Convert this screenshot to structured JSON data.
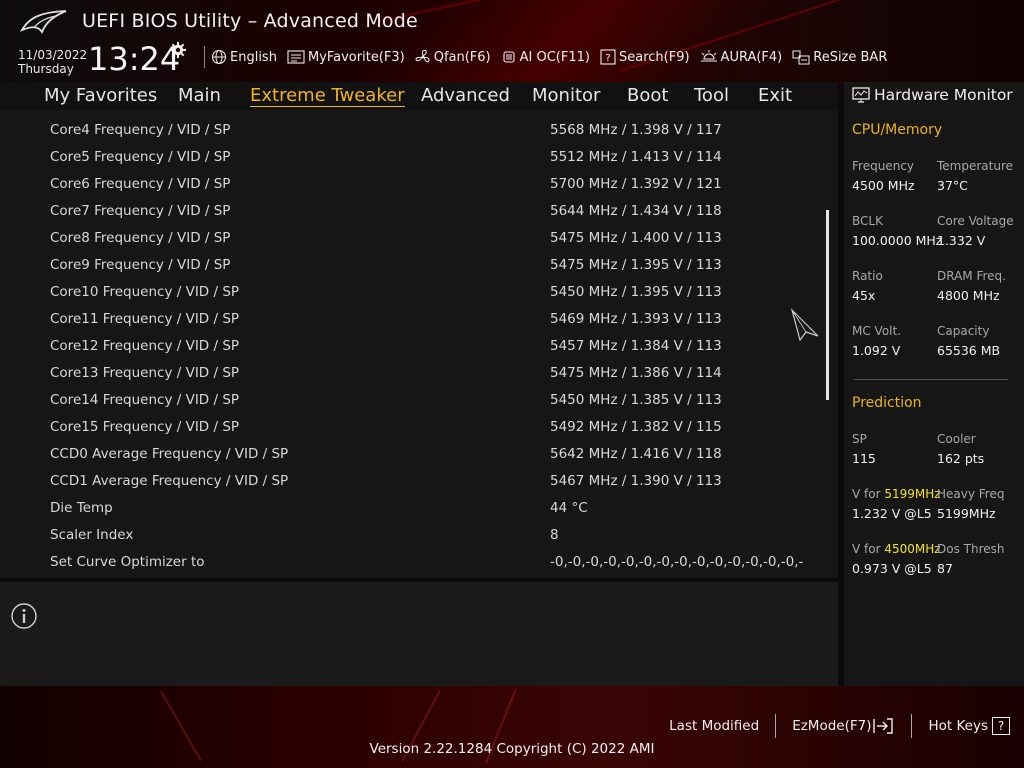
{
  "header": {
    "app_title": "UEFI BIOS Utility – Advanced Mode",
    "date": "11/03/2022",
    "day": "Thursday",
    "time": "13:24",
    "toolbar": [
      {
        "label": "English",
        "icon": "globe-icon"
      },
      {
        "label": "MyFavorite(F3)",
        "icon": "favorite-icon"
      },
      {
        "label": "Qfan(F6)",
        "icon": "fan-icon"
      },
      {
        "label": "AI OC(F11)",
        "icon": "ai-chip-icon"
      },
      {
        "label": "Search(F9)",
        "icon": "search-icon"
      },
      {
        "label": "AURA(F4)",
        "icon": "aura-icon"
      },
      {
        "label": "ReSize BAR",
        "icon": "resize-bar-icon"
      }
    ]
  },
  "nav": {
    "tabs": [
      "My Favorites",
      "Main",
      "Extreme Tweaker",
      "Advanced",
      "Monitor",
      "Boot",
      "Tool",
      "Exit"
    ],
    "active": "Extreme Tweaker"
  },
  "rows": [
    {
      "label": "Core4 Frequency / VID / SP",
      "value": "5568 MHz / 1.398 V / 117"
    },
    {
      "label": "Core5 Frequency / VID / SP",
      "value": "5512 MHz / 1.413 V / 114"
    },
    {
      "label": "Core6 Frequency / VID / SP",
      "value": "5700 MHz / 1.392 V / 121"
    },
    {
      "label": "Core7 Frequency / VID / SP",
      "value": "5644 MHz / 1.434 V / 118"
    },
    {
      "label": "Core8 Frequency / VID / SP",
      "value": "5475 MHz / 1.400 V / 113"
    },
    {
      "label": "Core9 Frequency / VID / SP",
      "value": "5475 MHz / 1.395 V / 113"
    },
    {
      "label": "Core10 Frequency / VID / SP",
      "value": "5450 MHz / 1.395 V / 113"
    },
    {
      "label": "Core11 Frequency / VID / SP",
      "value": "5469 MHz / 1.393 V / 113"
    },
    {
      "label": "Core12 Frequency / VID / SP",
      "value": "5457 MHz / 1.384 V / 113"
    },
    {
      "label": "Core13 Frequency / VID / SP",
      "value": "5475 MHz / 1.386 V / 114"
    },
    {
      "label": "Core14 Frequency / VID / SP",
      "value": "5450 MHz / 1.385 V / 113"
    },
    {
      "label": "Core15 Frequency / VID / SP",
      "value": "5492 MHz / 1.382 V / 115"
    },
    {
      "label": "CCD0 Average Frequency / VID / SP",
      "value": "5642 MHz / 1.416 V / 118"
    },
    {
      "label": "CCD1 Average Frequency / VID / SP",
      "value": "5467 MHz / 1.390 V / 113"
    },
    {
      "label": "Die Temp",
      "value": "44 °C"
    },
    {
      "label": "Scaler Index",
      "value": "8"
    },
    {
      "label": "Set Curve Optimizer to",
      "value": "-0,-0,-0,-0,-0,-0,-0,-0,-0,-0,-0,-0,-0,-0,-"
    }
  ],
  "hardware_monitor": {
    "title": "Hardware Monitor",
    "cpu_memory": {
      "heading": "CPU/Memory",
      "frequency_label": "Frequency",
      "frequency": "4500 MHz",
      "temperature_label": "Temperature",
      "temperature": "37°C",
      "bclk_label": "BCLK",
      "bclk": "100.0000 MHz",
      "core_voltage_label": "Core Voltage",
      "core_voltage": "1.332 V",
      "ratio_label": "Ratio",
      "ratio": "45x",
      "dram_freq_label": "DRAM Freq.",
      "dram_freq": "4800 MHz",
      "mc_volt_label": "MC Volt.",
      "mc_volt": "1.092 V",
      "capacity_label": "Capacity",
      "capacity": "65536 MB"
    },
    "prediction": {
      "heading": "Prediction",
      "sp_label": "SP",
      "sp": "115",
      "cooler_label": "Cooler",
      "cooler": "162 pts",
      "v_for_prefix_1": "V for ",
      "v_for_freq_1": "5199MHz",
      "v_for_value_1": "1.232 V @L5",
      "heavy_freq_label": "Heavy Freq",
      "heavy_freq": "5199MHz",
      "v_for_prefix_2": "V for ",
      "v_for_freq_2": "4500MHz",
      "v_for_value_2": "0.973 V @L5",
      "dos_thresh_label": "Dos Thresh",
      "dos_thresh": "87"
    }
  },
  "footer": {
    "last_modified": "Last Modified",
    "ezmode": "EzMode(F7)",
    "hot_keys": "Hot Keys",
    "hot_keys_glyph": "?",
    "version": "Version 2.22.1284 Copyright (C) 2022 AMI"
  },
  "colors": {
    "accent": "#f2b31a",
    "highlight": "#f2e22a",
    "brand_red": "#8b0000"
  }
}
